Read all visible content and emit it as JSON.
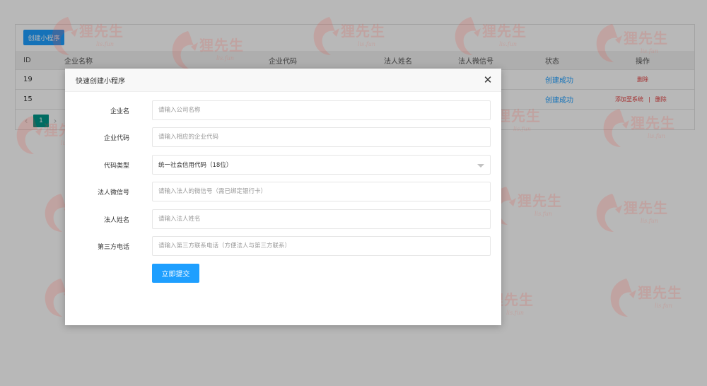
{
  "toolbar": {
    "create_label": "创建小程序"
  },
  "table": {
    "columns": {
      "id": "ID",
      "name": "企业名称",
      "code": "企业代码",
      "legal_name": "法人姓名",
      "legal_wechat": "法人微信号",
      "status": "状态",
      "ops": "操作"
    },
    "rows": [
      {
        "id": "19",
        "status": "创建成功",
        "ops": [
          "删除"
        ]
      },
      {
        "id": "15",
        "status": "创建成功",
        "ops": [
          "添加至系统",
          "删除"
        ],
        "separator": "|"
      }
    ]
  },
  "pagination": {
    "prev": "‹",
    "current": "1",
    "next": "›"
  },
  "watermark": {
    "text": "狸先生",
    "sub": "lis.fun",
    "color": "#e84a3c"
  },
  "modal": {
    "title": "快速创建小程序",
    "close_icon": "close-icon",
    "fields": [
      {
        "label": "企业名",
        "placeholder": "请输入公司名称"
      },
      {
        "label": "企业代码",
        "placeholder": "请输入相应的企业代码"
      },
      {
        "label": "代码类型",
        "value": "统一社会信用代码（18位）"
      },
      {
        "label": "法人微信号",
        "placeholder": "请输入法人的微信号（需已绑定银行卡）"
      },
      {
        "label": "法人姓名",
        "placeholder": "请输入法人姓名"
      },
      {
        "label": "第三方电话",
        "placeholder": "请输入第三方联系电话（方便法人与第三方联系）"
      }
    ],
    "submit_label": "立即提交"
  },
  "colors": {
    "primary": "#1e9fff",
    "pager_active": "#009688",
    "danger": "#e23c3c"
  }
}
